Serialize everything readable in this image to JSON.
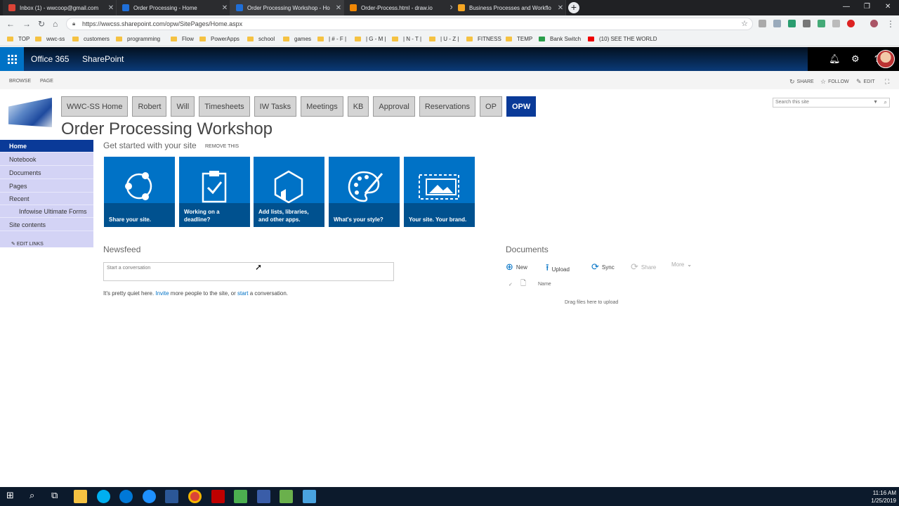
{
  "browser": {
    "tabs": [
      {
        "title": "Inbox (1) - wwcoop@gmail.com",
        "color": "#db4437"
      },
      {
        "title": "Order Processing - Home",
        "color": "#1f6fd8"
      },
      {
        "title": "Order Processing Workshop - Ho",
        "color": "#1f6fd8"
      },
      {
        "title": "Order-Process.html - draw.io",
        "color": "#f08705"
      },
      {
        "title": "Business Processes and Workflo",
        "color": "#f5a623"
      }
    ],
    "url": "https://wwcss.sharepoint.com/opw/SitePages/Home.aspx",
    "bookmarks": [
      "TOP",
      "wwc-ss",
      "customers",
      "programming",
      "Flow",
      "PowerApps",
      "school",
      "games",
      "| # - F |",
      "| G - M |",
      "| N - T |",
      "| U - Z |",
      "FITNESS",
      "TEMP",
      "Bank Switch",
      "(10) SEE THE WORLD"
    ]
  },
  "suitebar": {
    "office": "Office 365",
    "app": "SharePoint"
  },
  "ribbon": {
    "browse": "BROWSE",
    "page": "PAGE",
    "share": "SHARE",
    "follow": "FOLLOW",
    "edit": "EDIT"
  },
  "topnav": [
    "WWC-SS Home",
    "Robert",
    "Will",
    "Timesheets",
    "IW Tasks",
    "Meetings",
    "KB",
    "Approval",
    "Reservations",
    "OP",
    "OPW"
  ],
  "search_placeholder": "Search this site",
  "page_title": "Order Processing Workshop",
  "leftnav": {
    "items": [
      "Home",
      "Notebook",
      "Documents",
      "Pages",
      "Recent",
      "Infowise Ultimate Forms",
      "Site contents"
    ],
    "edit_links": "EDIT LINKS"
  },
  "get_started": {
    "title": "Get started with your site",
    "remove": "REMOVE THIS",
    "tiles": [
      "Share your site.",
      "Working on a deadline?",
      "Add lists, libraries, and other apps.",
      "What's your style?",
      "Your site. Your brand."
    ]
  },
  "newsfeed": {
    "title": "Newsfeed",
    "placeholder": "Start a conversation",
    "quiet_1": "It's pretty quiet here. ",
    "invite": "Invite",
    "quiet_2": " more people to the site, or ",
    "start": "start",
    "quiet_3": " a conversation."
  },
  "documents": {
    "title": "Documents",
    "actions": [
      "New",
      "Upload",
      "Sync",
      "Share",
      "More"
    ],
    "column": "Name",
    "drag": "Drag files here to upload"
  },
  "taskbar": {
    "time": "11:16 AM",
    "date": "1/25/2019"
  },
  "colors": {
    "sp_blue": "#0072c6",
    "nav_active": "#0a3a98",
    "leftnav_bg": "#d3d3f5"
  }
}
